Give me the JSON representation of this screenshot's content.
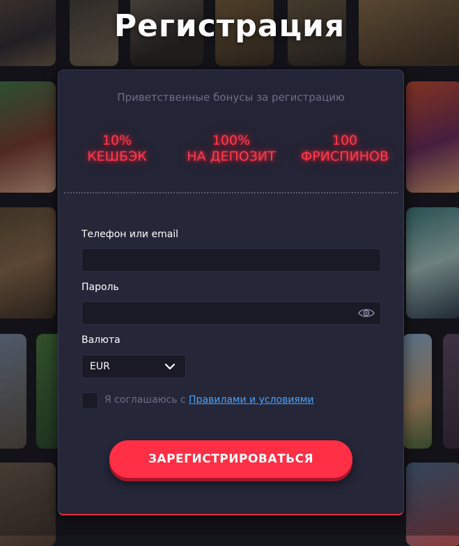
{
  "page": {
    "title": "Регистрация"
  },
  "bonuses": {
    "subtitle": "Приветственные бонусы за регистрацию",
    "items": [
      {
        "line1": "10%",
        "line2": "КЕШБЭК"
      },
      {
        "line1": "100%",
        "line2": "НА ДЕПОЗИТ"
      },
      {
        "line1": "100",
        "line2": "ФРИСПИНОВ"
      }
    ],
    "glow_color": "#ff2438"
  },
  "form": {
    "login_label": "Телефон или email",
    "login_value": "",
    "password_label": "Пароль",
    "password_value": "",
    "currency_label": "Валюта",
    "currency_value": "EUR",
    "agree_text": "Я соглашаюсь с ",
    "agree_link": "Правилами и условиями",
    "submit_label": "ЗАРЕГИСТРИРОВАТЬСЯ"
  },
  "colors": {
    "accent": "#ff2f45",
    "link": "#4aa3ff",
    "card": "#252638"
  }
}
